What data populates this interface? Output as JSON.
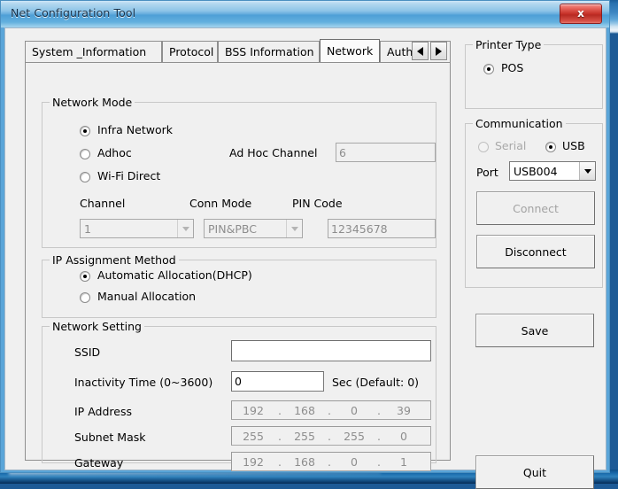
{
  "window": {
    "title": "Net Configuration Tool",
    "close_label": "x",
    "close_icon": "close-icon"
  },
  "tabs": {
    "items": [
      {
        "label": "System _Information",
        "active": false
      },
      {
        "label": "Protocol",
        "active": false
      },
      {
        "label": "BSS Information",
        "active": false
      },
      {
        "label": "Network",
        "active": true
      },
      {
        "label": "Authe",
        "active": false
      }
    ],
    "scroll_left_icon": "triangle-left-icon",
    "scroll_right_icon": "triangle-right-icon"
  },
  "network_mode": {
    "legend": "Network Mode",
    "options": [
      {
        "label": "Infra Network",
        "checked": true,
        "disabled": false
      },
      {
        "label": "Adhoc",
        "checked": false,
        "disabled": false
      },
      {
        "label": "Wi-Fi Direct",
        "checked": false,
        "disabled": false
      }
    ],
    "adhoc_channel_label": "Ad Hoc Channel",
    "adhoc_channel_value": "6",
    "channel_label": "Channel",
    "channel_value": "1",
    "conn_mode_label": "Conn Mode",
    "conn_mode_value": "PIN&PBC",
    "pin_code_label": "PIN Code",
    "pin_code_value": "12345678"
  },
  "ip_assignment": {
    "legend": "IP Assignment Method",
    "options": [
      {
        "label": "Automatic Allocation(DHCP)",
        "checked": true
      },
      {
        "label": "Manual Allocation",
        "checked": false
      }
    ]
  },
  "network_setting": {
    "legend": "Network Setting",
    "ssid_label": "SSID",
    "ssid_value": "",
    "inactivity_label": "Inactivity Time (0~3600)",
    "inactivity_value": "0",
    "inactivity_suffix": "Sec (Default: 0)",
    "ip_address_label": "IP Address",
    "ip_address": [
      "192",
      "168",
      "0",
      "39"
    ],
    "subnet_mask_label": "Subnet Mask",
    "subnet_mask": [
      "255",
      "255",
      "255",
      "0"
    ],
    "gateway_label": "Gateway",
    "gateway": [
      "192",
      "168",
      "0",
      "1"
    ]
  },
  "printer_type": {
    "legend": "Printer Type",
    "options": [
      {
        "label": "POS",
        "checked": true
      }
    ]
  },
  "communication": {
    "legend": "Communication",
    "serial_label": "Serial",
    "serial_checked": false,
    "serial_disabled": true,
    "usb_label": "USB",
    "usb_checked": true,
    "port_label": "Port",
    "port_value": "USB004",
    "connect_label": "Connect",
    "connect_disabled": true,
    "disconnect_label": "Disconnect"
  },
  "actions": {
    "save_label": "Save",
    "quit_label": "Quit"
  }
}
